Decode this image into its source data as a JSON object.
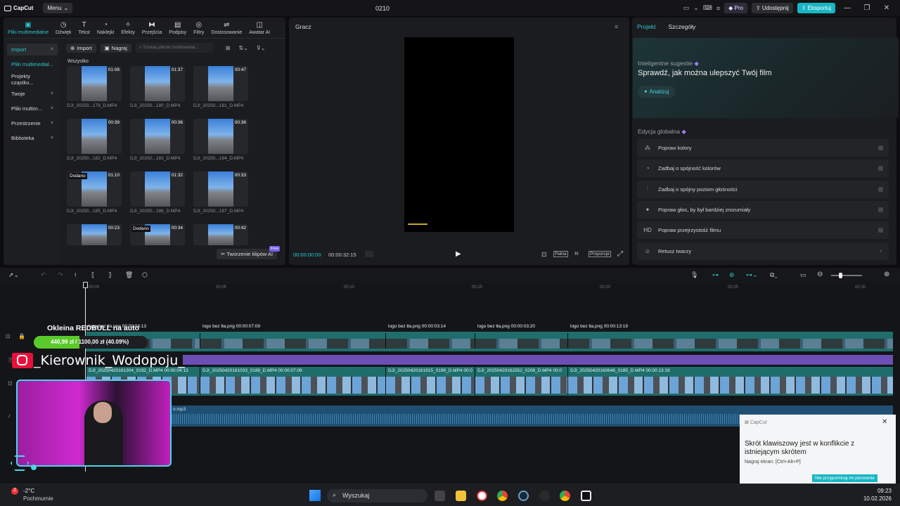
{
  "app": {
    "logo": "CapCut",
    "menu_label": "Menu",
    "project_title": "0210"
  },
  "titlebar": {
    "pro_label": "Pro",
    "share_label": "Udostępnij",
    "export_label": "Eksportuj"
  },
  "toolbar_tabs": [
    {
      "label": "Pliki multimedialne",
      "icon": "media-icon"
    },
    {
      "label": "Dźwięk",
      "icon": "audio-icon"
    },
    {
      "label": "Tekst",
      "icon": "text-icon"
    },
    {
      "label": "Naklejki",
      "icon": "sticker-icon"
    },
    {
      "label": "Efekty",
      "icon": "effects-icon"
    },
    {
      "label": "Przejścia",
      "icon": "transition-icon"
    },
    {
      "label": "Podpisy",
      "icon": "captions-icon"
    },
    {
      "label": "Filtry",
      "icon": "filter-icon"
    },
    {
      "label": "Dostosowanie",
      "icon": "adjust-icon"
    },
    {
      "label": "Awatar AI",
      "icon": "avatar-icon"
    }
  ],
  "sidebar": [
    {
      "label": "Import",
      "chevron": "˄"
    },
    {
      "label": "Pliki multimedial...",
      "chevron": ""
    },
    {
      "label": "Projekty cząstko...",
      "chevron": ""
    },
    {
      "label": "Twoje",
      "chevron": "˅"
    },
    {
      "label": "Pliki multim...",
      "chevron": "˅"
    },
    {
      "label": "Przestrzenie",
      "chevron": "˅"
    },
    {
      "label": "Biblioteka",
      "chevron": "˅"
    }
  ],
  "media": {
    "import_label": "Import",
    "record_label": "Nagraj",
    "search_placeholder": "Szukaj plików multimedial...",
    "all_label": "Wszystko",
    "items": [
      {
        "name": "DJI_20250...179_D.MP4",
        "duration": "01:08",
        "badge": ""
      },
      {
        "name": "DJI_20250...180_D.MP4",
        "duration": "01:37",
        "badge": ""
      },
      {
        "name": "DJI_20250...181_D.MP4",
        "duration": "00:47",
        "badge": ""
      },
      {
        "name": "DJI_20250...182_D.MP4",
        "duration": "00:39",
        "badge": ""
      },
      {
        "name": "DJI_20250...183_D.MP4",
        "duration": "00:36",
        "badge": ""
      },
      {
        "name": "DJI_20250...184_D.MP4",
        "duration": "00:36",
        "badge": ""
      },
      {
        "name": "DJI_20250...185_D.MP4",
        "duration": "01:10",
        "badge": "Dodano"
      },
      {
        "name": "DJI_20250...186_D.MP4",
        "duration": "01:32",
        "badge": ""
      },
      {
        "name": "DJI_20250...187_D.MP4",
        "duration": "00:33",
        "badge": ""
      },
      {
        "name": "",
        "duration": "00:23",
        "badge": ""
      },
      {
        "name": "",
        "duration": "00:34",
        "badge": "Dodano"
      },
      {
        "name": "",
        "duration": "00:42",
        "badge": ""
      }
    ],
    "ai_create_label": "Tworzenie klipów AI",
    "free_tag": "Free"
  },
  "player": {
    "title": "Gracz",
    "time_current": "00:00:00:00",
    "time_total": "00:00:32:15",
    "full_label": "Pełna",
    "ratio_label": "Proporcje"
  },
  "right_panel": {
    "tab_project": "Projekt",
    "tab_details": "Szczegóły",
    "ai_label": "Inteligentne sugestie",
    "ai_heading": "Sprawdź, jak można ulepszyć Twój film",
    "analyze_label": "Analizuj",
    "global_label": "Edycja globalna",
    "global_items": [
      {
        "label": "Popraw kolory",
        "icon": "magic-wand-icon",
        "glyph": "⁂"
      },
      {
        "label": "Zadbaj o spójność kolorów",
        "icon": "color-match-icon",
        "glyph": "◔"
      },
      {
        "label": "Zadbaj o spójny poziom głośności",
        "icon": "volume-level-icon",
        "glyph": "⫶"
      },
      {
        "label": "Popraw głos, by był bardziej zrozumiały",
        "icon": "voice-enhance-icon",
        "glyph": "✦"
      },
      {
        "label": "Popraw przejrzystość filmu",
        "icon": "hd-icon",
        "glyph": "HD"
      },
      {
        "label": "Retusz twarzy",
        "icon": "face-retouch-icon",
        "glyph": "☺"
      }
    ]
  },
  "timeline": {
    "ruler_ticks": [
      "00:00",
      "00:05",
      "00:10",
      "00:15",
      "00:20",
      "00:25",
      "00:30"
    ],
    "sticker_clips": [
      {
        "label": "logo bez tła.png  00:00:04:13"
      },
      {
        "label": "logo bez tła.png  00:00:07:09"
      },
      {
        "label": "logo bez tła.png  00:00:03:14"
      },
      {
        "label": "logo bez tła.png  00:00:03:20"
      },
      {
        "label": "logo bez tła.png  00:00:13:19"
      }
    ],
    "video_clips": [
      {
        "label": "DJI_20250420161304_0192_D.MP4  00:00:04:13"
      },
      {
        "label": "DJI_20250420161033_0189_D.MP4  00:00:07:09"
      },
      {
        "label": "DJI_20250420161915_0199_D.MP4  00:0"
      },
      {
        "label": "DJI_20250420162552_0208_D.MP4  00:0"
      },
      {
        "label": "DJI_20250420160646_0185_D.MP4  00:00:13:19"
      }
    ],
    "audio_label": "o.mp3"
  },
  "stream_overlay": {
    "goal_title": "Okleina REDBULL na auto",
    "goal_current": "440,99 zł",
    "goal_target": "1100,00 zł",
    "goal_percent": "(40.09%)",
    "goal_fraction": 0.4009,
    "instagram_name": "_Kierownik_Wodopoju_"
  },
  "toast": {
    "app_name": "CapCut",
    "title": "Skrót klawiszowy jest w konflikcie z istniejącym skrótem",
    "subtitle": "Nagraj ekran: [Ctrl+Alt+P]",
    "button": "Nie przypominaj mi ponownie"
  },
  "taskbar": {
    "weather_temp": "-2°C",
    "weather_desc": "Pochmurnie",
    "weather_badge": "2",
    "search_label": "Wyszukaj",
    "time": "09:23",
    "date": "10.02.2026"
  },
  "colors": {
    "accent": "#29c8d2",
    "export": "#17b6c4",
    "goal_bar": "#5aca2a",
    "track_teal": "#1f6e6c",
    "track_purple": "#6b4fb5"
  }
}
